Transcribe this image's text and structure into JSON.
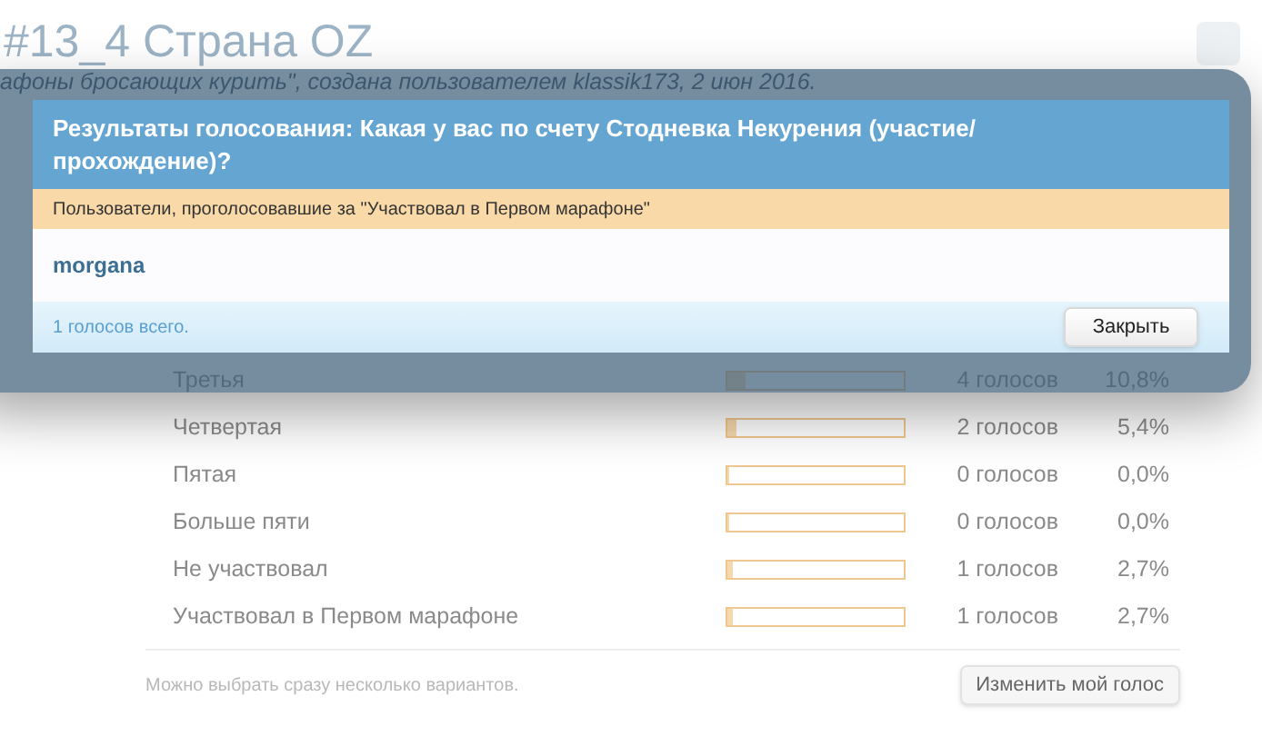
{
  "page": {
    "title": "#13_4 Страна OZ",
    "subtitle": "афоны бросающих курить\", создана пользователем klassik173, 2 июн 2016."
  },
  "poll": {
    "options": [
      {
        "label": "Третья",
        "level": 0.108,
        "votes": "4 голосов",
        "percent": "10,8%"
      },
      {
        "label": "Четвертая",
        "level": 0.054,
        "votes": "2 голосов",
        "percent": "5,4%"
      },
      {
        "label": "Пятая",
        "level": 0,
        "votes": "0 голосов",
        "percent": "0,0%"
      },
      {
        "label": "Больше пяти",
        "level": 0,
        "votes": "0 голосов",
        "percent": "0,0%"
      },
      {
        "label": "Не участвовал",
        "level": 0.027,
        "votes": "1 голосов",
        "percent": "2,7%"
      },
      {
        "label": "Участвовал в Первом марафоне",
        "level": 0.027,
        "votes": "1 голосов",
        "percent": "2,7%"
      }
    ],
    "note": "Можно выбрать сразу несколько вариантов.",
    "change_button": "Изменить мой голос"
  },
  "dialog": {
    "title": "Результаты голосования: Какая у вас по счету Стодневка Некурения (участие/прохождение)?",
    "subheader": "Пользователи, проголосовавшие за \"Участвовал в Первом марафоне\"",
    "voters": [
      "morgana"
    ],
    "total": "1 голосов всего.",
    "close_button": "Закрыть"
  }
}
